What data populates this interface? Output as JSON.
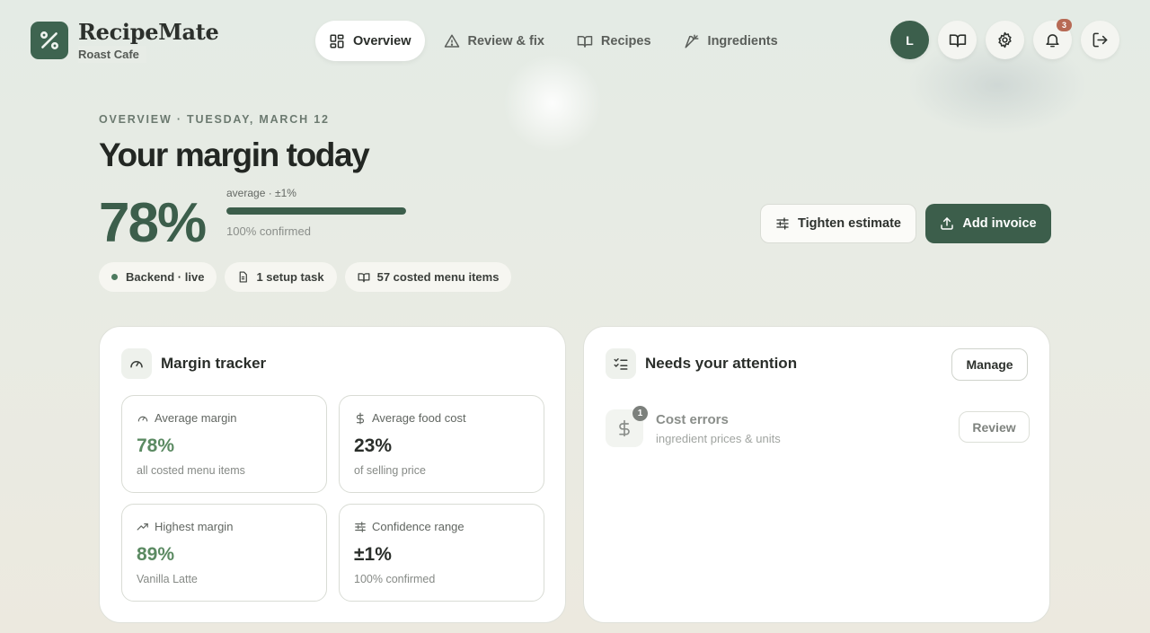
{
  "brand": {
    "name": "RecipeMate",
    "location": "Roast Cafe",
    "logo_icon": "percent-icon",
    "accent": "#3c5e4b"
  },
  "nav": {
    "items": [
      {
        "label": "Overview",
        "icon": "grid-icon",
        "active": true
      },
      {
        "label": "Review & fix",
        "icon": "warning-icon",
        "active": false
      },
      {
        "label": "Recipes",
        "icon": "book-open-icon",
        "active": false
      },
      {
        "label": "Ingredients",
        "icon": "carrot-icon",
        "active": false
      }
    ]
  },
  "header_actions": {
    "avatar_initial": "L",
    "notifications_count": "3",
    "icons": [
      "book-icon",
      "gear-icon",
      "bell-icon",
      "logout-icon"
    ]
  },
  "hero": {
    "eyebrow": "OVERVIEW · TUESDAY, MARCH 12",
    "title": "Your margin today",
    "margin_value": "78%",
    "range_label": "average · ±1%",
    "confirmed_fraction": 1.0,
    "confirmed_label": "100% confirmed"
  },
  "pills": [
    {
      "label": "Backend · live",
      "icon": "status-dot"
    },
    {
      "label": "1 setup task",
      "icon": "document-icon"
    },
    {
      "label": "57 costed menu items",
      "icon": "book-open-icon"
    }
  ],
  "buttons": {
    "tighten": "Tighten estimate",
    "add_invoice": "Add invoice"
  },
  "margin_tracker": {
    "title": "Margin tracker",
    "stats": [
      {
        "label": "Average margin",
        "value": "78%",
        "sub": "all costed menu items",
        "icon": "gauge-icon"
      },
      {
        "label": "Average food cost",
        "value": "23%",
        "sub": "of selling price",
        "icon": "dollar-icon"
      },
      {
        "label": "Highest margin",
        "value": "89%",
        "sub": "Vanilla Latte",
        "icon": "trending-up-icon"
      },
      {
        "label": "Confidence range",
        "value": "±1%",
        "sub": "100% confirmed",
        "icon": "sliders-icon"
      }
    ]
  },
  "attention": {
    "title": "Needs your attention",
    "manage_label": "Manage",
    "items": [
      {
        "title": "Cost errors",
        "sub": "ingredient prices & units",
        "count": "1",
        "action": "Review",
        "icon": "dollar-icon"
      }
    ]
  }
}
